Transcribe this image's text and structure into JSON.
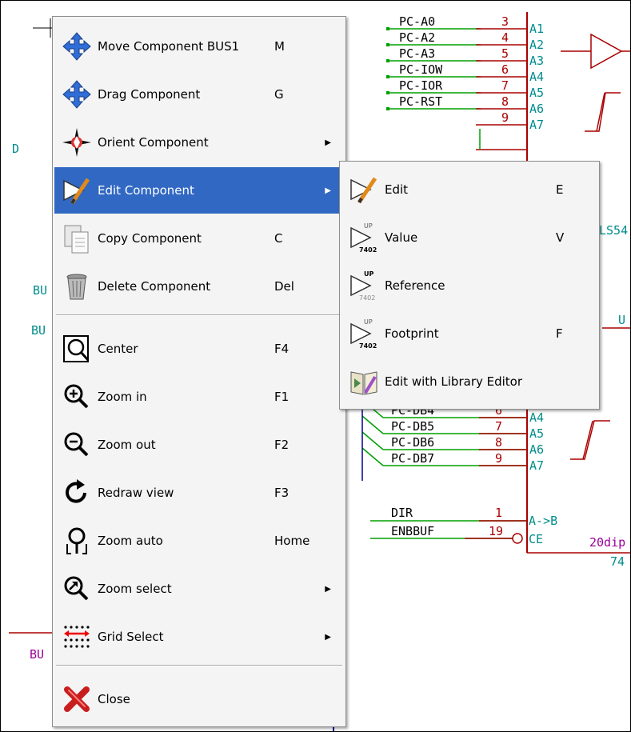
{
  "schematic": {
    "nets_top": [
      "PC-A0",
      "PC-A2",
      "PC-A3",
      "PC-IOW",
      "PC-IOR",
      "PC-RST"
    ],
    "pins_top": [
      "3",
      "4",
      "5",
      "6",
      "7",
      "8",
      "9"
    ],
    "ports_top": [
      "A1",
      "A2",
      "A3",
      "A4",
      "A5",
      "A6",
      "A7"
    ],
    "nets_bottom": [
      "PC-DB4",
      "PC-DB5",
      "PC-DB6",
      "PC-DB7"
    ],
    "pins_bottom": [
      "6",
      "7",
      "8",
      "9"
    ],
    "ports_bottom": [
      "A4",
      "A5",
      "A6",
      "A7"
    ],
    "dir_net": "DIR",
    "dir_pin": "1",
    "dir_port": "A->B",
    "enb_net": "ENBBUF",
    "enb_pin": "19",
    "enb_port": "CE",
    "package_label": "20dip",
    "part_label": "74",
    "ls_label": "LS54",
    "u_label": "U",
    "d_label": "D",
    "bus_label_1": "BU",
    "bus_label_2": "BU",
    "bus_label_3": "BU"
  },
  "context_menu": {
    "items": [
      {
        "label": "Move Component BUS1",
        "shortcut": "M",
        "icon": "move-icon"
      },
      {
        "label": "Drag Component",
        "shortcut": "G",
        "icon": "drag-icon"
      },
      {
        "label": "Orient Component",
        "shortcut": "",
        "icon": "compass-icon",
        "submenu": true
      },
      {
        "label": "Edit Component",
        "shortcut": "",
        "icon": "edit-component-icon",
        "submenu": true,
        "highlighted": true
      },
      {
        "label": "Copy Component",
        "shortcut": "C",
        "icon": "copy-icon"
      },
      {
        "label": "Delete Component",
        "shortcut": "Del",
        "icon": "trash-icon"
      },
      {
        "label": "Center",
        "shortcut": "F4",
        "icon": "center-icon"
      },
      {
        "label": "Zoom in",
        "shortcut": "F1",
        "icon": "zoom-in-icon"
      },
      {
        "label": "Zoom out",
        "shortcut": "F2",
        "icon": "zoom-out-icon"
      },
      {
        "label": "Redraw view",
        "shortcut": "F3",
        "icon": "redraw-icon"
      },
      {
        "label": "Zoom auto",
        "shortcut": "Home",
        "icon": "zoom-auto-icon"
      },
      {
        "label": "Zoom select",
        "shortcut": "",
        "icon": "zoom-select-icon",
        "submenu": true
      },
      {
        "label": "Grid Select",
        "shortcut": "",
        "icon": "grid-icon",
        "submenu": true
      },
      {
        "label": "Close",
        "shortcut": "",
        "icon": "close-icon"
      }
    ]
  },
  "edit_submenu": {
    "items": [
      {
        "label": "Edit",
        "shortcut": "E",
        "icon": "edit-icon"
      },
      {
        "label": "Value",
        "shortcut": "V",
        "icon": "value-icon"
      },
      {
        "label": "Reference",
        "shortcut": "",
        "icon": "reference-icon"
      },
      {
        "label": "Footprint",
        "shortcut": "F",
        "icon": "footprint-icon"
      },
      {
        "label": "Edit with Library Editor",
        "shortcut": "",
        "icon": "library-editor-icon"
      }
    ],
    "icon_badge_top": "UP",
    "icon_badge_bottom": "7402"
  },
  "colors": {
    "highlight": "#3168c3",
    "pin_red": "#aa0000",
    "wire_green": "#00a000",
    "label_teal": "#008c8c",
    "label_purple": "#9b009b"
  }
}
